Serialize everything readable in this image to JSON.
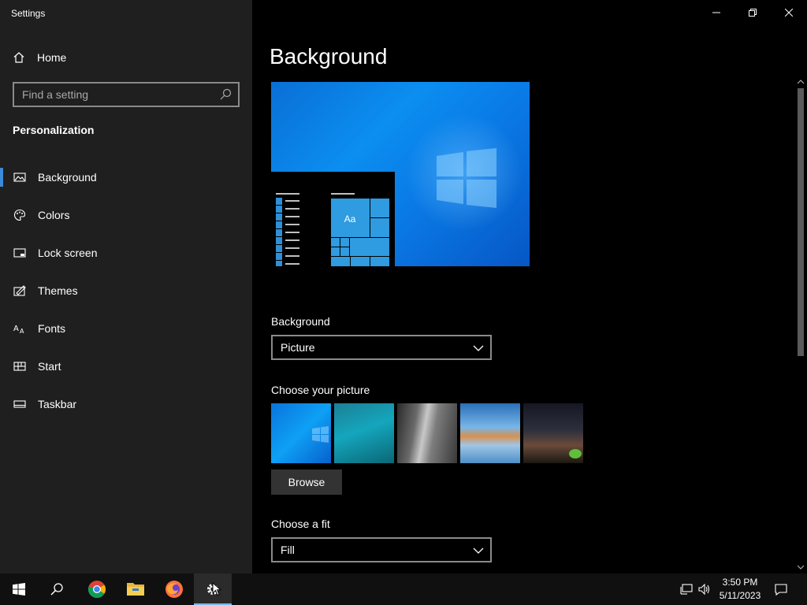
{
  "window": {
    "title": "Settings"
  },
  "sidebar": {
    "home_label": "Home",
    "search_placeholder": "Find a setting",
    "section_title": "Personalization",
    "items": [
      {
        "label": "Background",
        "icon": "image-icon",
        "active": true
      },
      {
        "label": "Colors",
        "icon": "palette-icon"
      },
      {
        "label": "Lock screen",
        "icon": "lock-screen-icon"
      },
      {
        "label": "Themes",
        "icon": "themes-icon"
      },
      {
        "label": "Fonts",
        "icon": "fonts-icon"
      },
      {
        "label": "Start",
        "icon": "start-icon"
      },
      {
        "label": "Taskbar",
        "icon": "taskbar-icon"
      }
    ]
  },
  "main": {
    "title": "Background",
    "preview": {
      "tile_text": "Aa"
    },
    "background_label": "Background",
    "background_value": "Picture",
    "choose_picture_label": "Choose your picture",
    "browse_label": "Browse",
    "fit_label": "Choose a fit",
    "fit_value": "Fill"
  },
  "taskbar": {
    "apps": [
      "start-button",
      "search-button",
      "chrome",
      "file-explorer",
      "firefox",
      "settings"
    ],
    "time": "3:50 PM",
    "date": "5/11/2023"
  },
  "colors": {
    "accent": "#3c8ad9",
    "sidebar_bg": "#1f1f1f",
    "main_bg": "#000000",
    "taskbar_bg": "#101010"
  }
}
